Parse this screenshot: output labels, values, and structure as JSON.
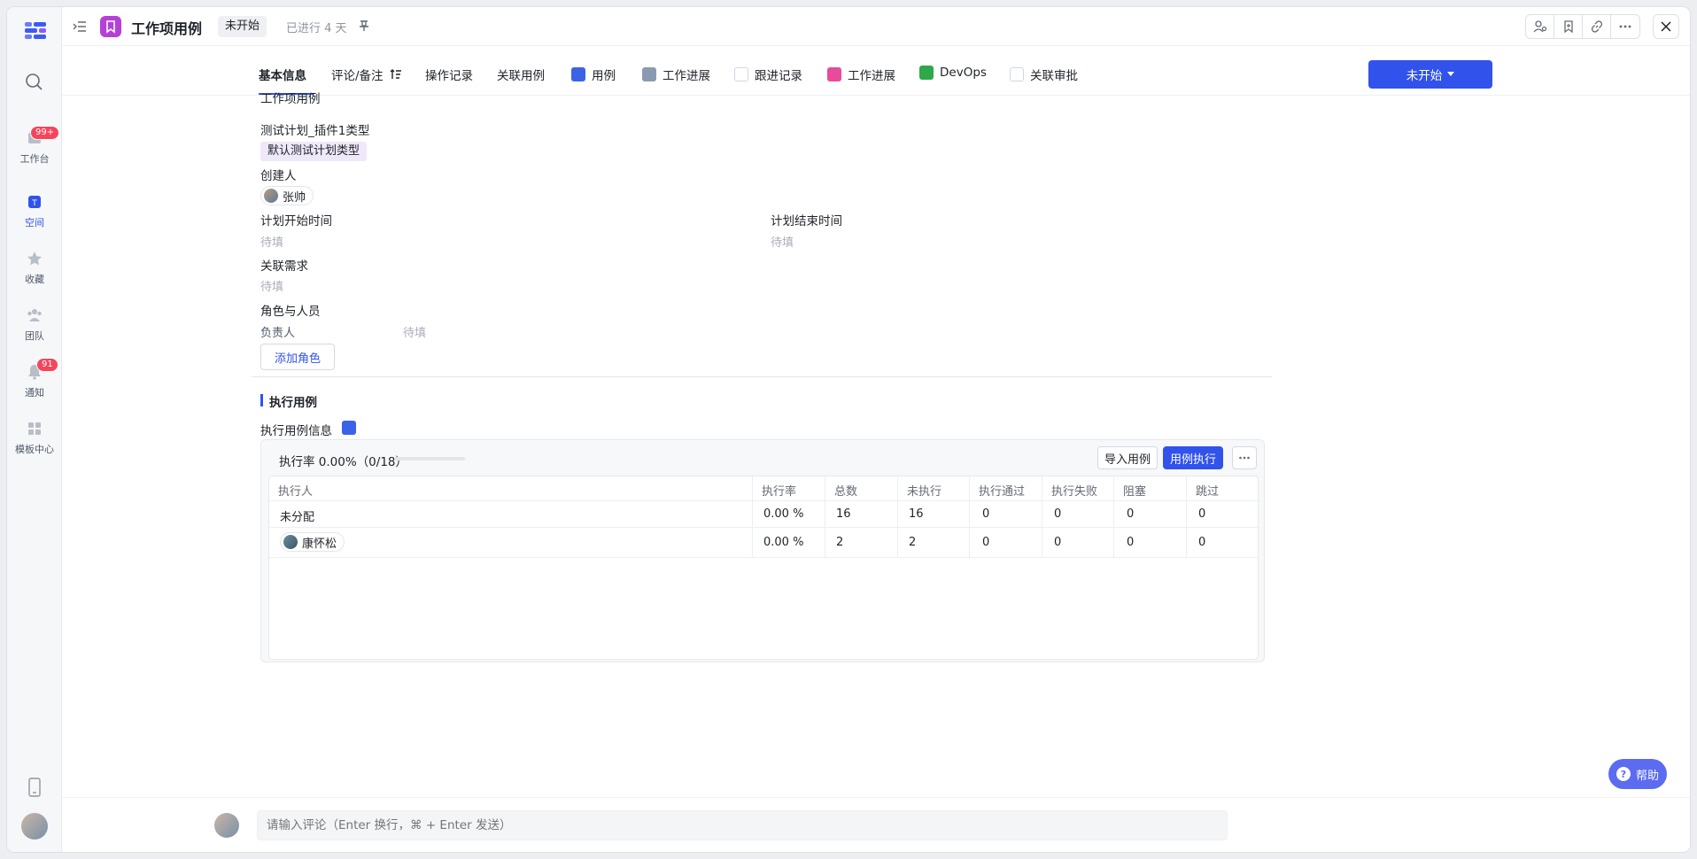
{
  "rail": {
    "items": [
      {
        "label": "工作台",
        "badge": "99+",
        "icon": "workbench-icon"
      },
      {
        "label": "空间",
        "icon": "space-icon"
      },
      {
        "label": "收藏",
        "icon": "star-icon"
      },
      {
        "label": "团队",
        "icon": "team-icon"
      },
      {
        "label": "通知",
        "badge": "91",
        "icon": "bell-icon"
      },
      {
        "label": "模板中心",
        "icon": "template-icon"
      }
    ]
  },
  "header": {
    "title": "工作项用例",
    "status": "未开始",
    "elapsed": "已进行 4 天"
  },
  "tabs": [
    {
      "label": "基本信息"
    },
    {
      "label": "评论/备注"
    },
    {
      "label": "操作记录"
    },
    {
      "label": "关联用例"
    },
    {
      "label": "用例",
      "color": "#3b63e8"
    },
    {
      "label": "工作进展",
      "color": "#8a9bb1"
    },
    {
      "label": "跟进记录",
      "color": "#4e7be8"
    },
    {
      "label": "工作进展",
      "color": "#e84b9b"
    },
    {
      "label": "DevOps",
      "color": "#2ea84a"
    },
    {
      "label": "关联审批",
      "color": "#6f6de8"
    }
  ],
  "status_button": "未开始",
  "detail": {
    "section_title": "工作项用例",
    "plan_type_label": "测试计划_插件1类型",
    "plan_type_value": "默认测试计划类型",
    "creator_label": "创建人",
    "creator_name": "张帅",
    "start_label": "计划开始时间",
    "start_value": "待填",
    "end_label": "计划结束时间",
    "end_value": "待填",
    "req_label": "关联需求",
    "req_value": "待填",
    "roles_label": "角色与人员",
    "owner_label": "负责人",
    "owner_value": "待填",
    "add_role": "添加角色"
  },
  "exec": {
    "section_title": "执行用例",
    "info_label": "执行用例信息",
    "rate_text": "执行率 0.00%（0/18）",
    "progress": 0.0,
    "import_btn": "导入用例",
    "run_btn": "用例执行",
    "columns": [
      "执行人",
      "执行率",
      "总数",
      "未执行",
      "执行通过",
      "执行失败",
      "阻塞",
      "跳过"
    ],
    "rows": [
      [
        "未分配",
        "0.00 %",
        "16",
        "16",
        "0",
        "0",
        "0",
        "0"
      ],
      [
        "康怀松",
        "0.00 %",
        "2",
        "2",
        "0",
        "0",
        "0",
        "0"
      ]
    ]
  },
  "comment": {
    "placeholder": "请输入评论（Enter 换行，⌘ + Enter 发送）"
  },
  "help": "帮助"
}
